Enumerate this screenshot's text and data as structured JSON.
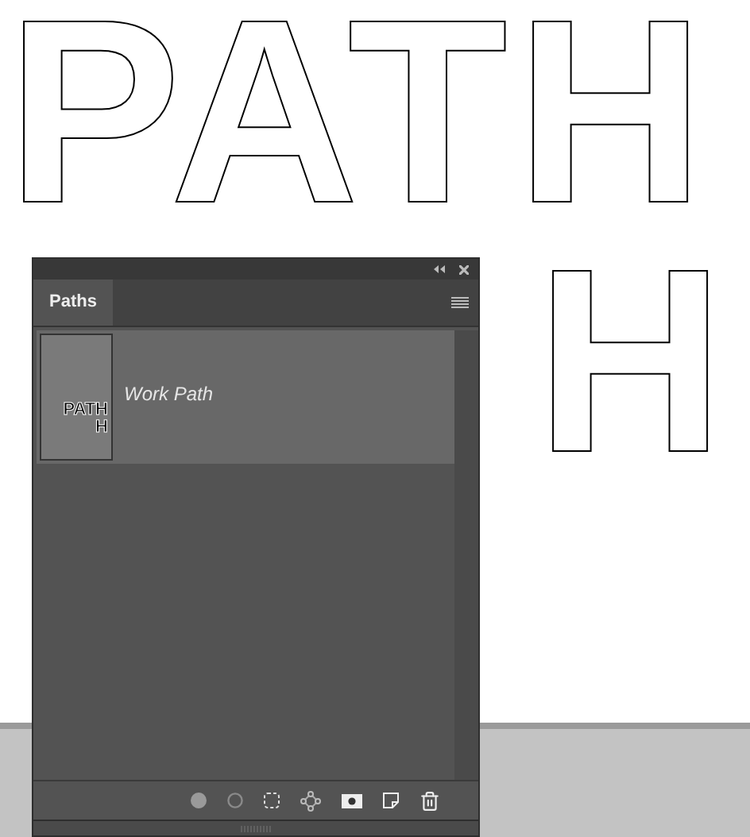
{
  "canvas": {
    "lines": [
      "PATH",
      "H"
    ]
  },
  "panel": {
    "tabs": [
      {
        "label": "Paths",
        "selected": true
      }
    ],
    "paths": [
      {
        "name": "Work Path",
        "selected": true,
        "thumbnail": [
          "PATH",
          "H"
        ]
      }
    ]
  }
}
